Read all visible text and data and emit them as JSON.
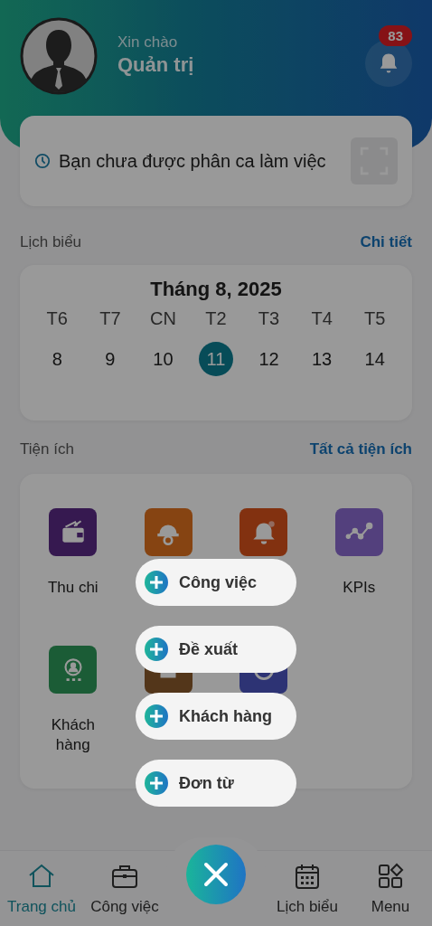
{
  "header": {
    "greeting": "Xin chào",
    "user_name": "Quản trị",
    "notification_count": "83"
  },
  "shift_card": {
    "message": "Bạn chưa được phân ca làm việc"
  },
  "schedule": {
    "title": "Lịch biểu",
    "link": "Chi tiết",
    "month": "Tháng 8, 2025",
    "days": [
      {
        "weekday": "T6",
        "date": "8",
        "selected": false
      },
      {
        "weekday": "T7",
        "date": "9",
        "selected": false
      },
      {
        "weekday": "CN",
        "date": "10",
        "selected": false
      },
      {
        "weekday": "T2",
        "date": "11",
        "selected": true
      },
      {
        "weekday": "T3",
        "date": "12",
        "selected": false
      },
      {
        "weekday": "T4",
        "date": "13",
        "selected": false
      },
      {
        "weekday": "T5",
        "date": "14",
        "selected": false
      }
    ]
  },
  "utilities": {
    "title": "Tiện ích",
    "link": "Tất cả tiện ích",
    "tiles": [
      {
        "kind": "wallet",
        "label": "Thu chi"
      },
      {
        "kind": "helmet"
      },
      {
        "kind": "bell"
      },
      {
        "kind": "chart",
        "label": "KPIs"
      },
      {
        "kind": "customer",
        "label": "Khách hàng"
      },
      {
        "kind": "box"
      },
      {
        "kind": "pie"
      }
    ]
  },
  "quick_add_menu": [
    "Công việc",
    "Đề xuất",
    "Khách hàng",
    "Đơn từ"
  ],
  "bottom_nav": [
    {
      "label": "Trang chủ",
      "selected": true
    },
    {
      "label": "Công việc",
      "selected": false
    },
    {
      "label": "Lịch biểu",
      "selected": false
    },
    {
      "label": "Menu",
      "selected": false
    }
  ]
}
